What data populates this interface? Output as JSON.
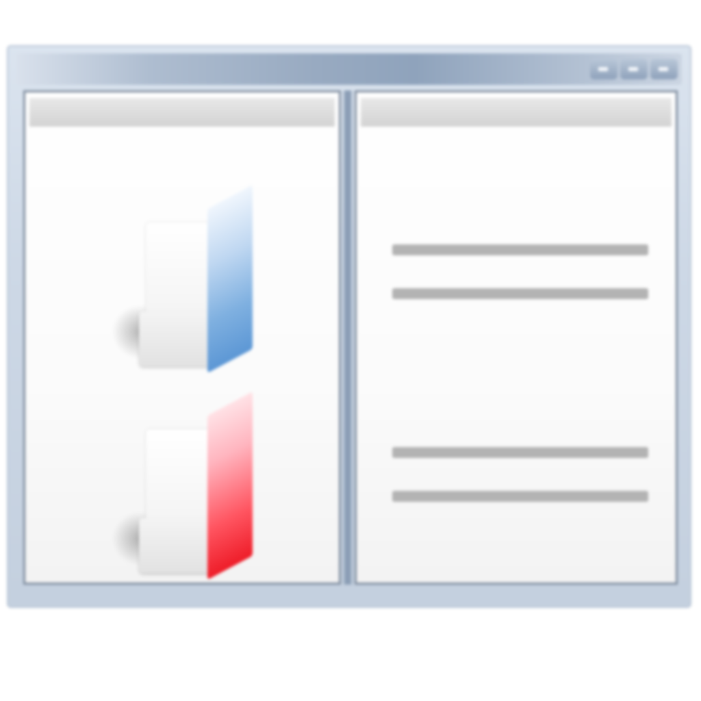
{
  "window": {
    "controls": [
      {
        "name": "minimize-button",
        "icon": "minimize-icon"
      },
      {
        "name": "maximize-button",
        "icon": "maximize-icon"
      },
      {
        "name": "close-button",
        "icon": "close-icon"
      }
    ]
  },
  "left_pane": {
    "items": [
      {
        "icon": "folder-icon",
        "accent": "#5c97d5"
      },
      {
        "icon": "folder-icon",
        "accent": "#ee1c28"
      }
    ]
  },
  "right_pane": {
    "line_color": "#b3b3b3"
  },
  "colors": {
    "frame": "#c4d0df",
    "titlebar": "#98aac1",
    "pane_border": "#7d8b9d",
    "pane_header": "#d3d3d3"
  }
}
